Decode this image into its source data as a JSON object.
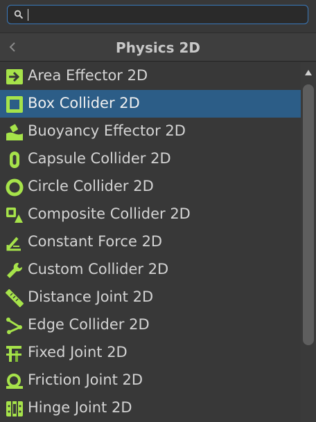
{
  "search": {
    "value": "",
    "placeholder": ""
  },
  "header": {
    "title": "Physics 2D"
  },
  "colors": {
    "accent": "#3a79bb",
    "selection": "#2c5d87",
    "icon_green": "#a6e34a"
  },
  "items": [
    {
      "label": "Area Effector 2D",
      "icon": "area-effector-icon",
      "selected": false
    },
    {
      "label": "Box Collider 2D",
      "icon": "box-collider-icon",
      "selected": true
    },
    {
      "label": "Buoyancy Effector 2D",
      "icon": "buoyancy-effector-icon",
      "selected": false
    },
    {
      "label": "Capsule Collider 2D",
      "icon": "capsule-collider-icon",
      "selected": false
    },
    {
      "label": "Circle Collider 2D",
      "icon": "circle-collider-icon",
      "selected": false
    },
    {
      "label": "Composite Collider 2D",
      "icon": "composite-collider-icon",
      "selected": false
    },
    {
      "label": "Constant Force 2D",
      "icon": "constant-force-icon",
      "selected": false
    },
    {
      "label": "Custom Collider 2D",
      "icon": "custom-collider-icon",
      "selected": false
    },
    {
      "label": "Distance Joint 2D",
      "icon": "distance-joint-icon",
      "selected": false
    },
    {
      "label": "Edge Collider 2D",
      "icon": "edge-collider-icon",
      "selected": false
    },
    {
      "label": "Fixed Joint 2D",
      "icon": "fixed-joint-icon",
      "selected": false
    },
    {
      "label": "Friction Joint 2D",
      "icon": "friction-joint-icon",
      "selected": false
    },
    {
      "label": "Hinge Joint 2D",
      "icon": "hinge-joint-icon",
      "selected": false
    }
  ]
}
